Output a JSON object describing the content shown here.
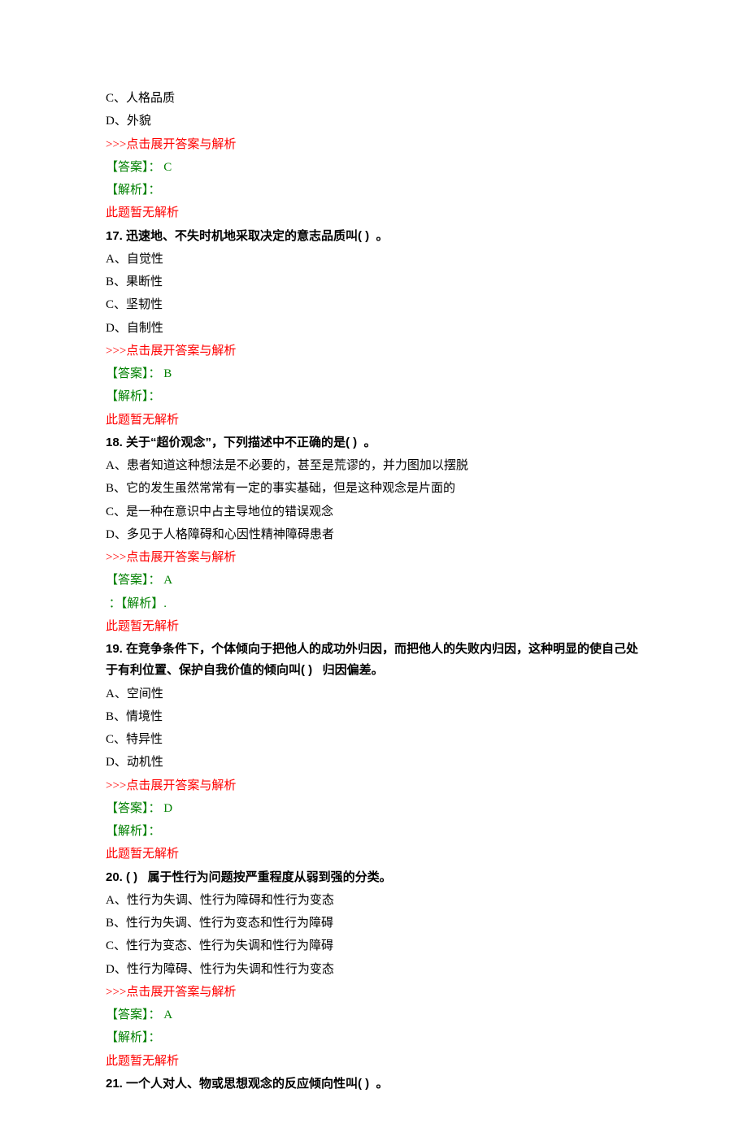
{
  "q16_tail": {
    "optC": "C、人格品质",
    "optD": "D、外貌",
    "toggle": ">>>点击展开答案与解析",
    "answer": "【答案】： C",
    "jiexiLabel": "【解析】：",
    "noJiexi": "此题暂无解析"
  },
  "q17": {
    "stem": "17. 迅速地、不失时机地采取决定的意志品质叫( )  。",
    "optA": "A、自觉性",
    "optB": "B、果断性",
    "optC": "C、坚韧性",
    "optD": "D、自制性",
    "toggle": ">>>点击展开答案与解析",
    "answer": "【答案】： B",
    "jiexiLabel": "【解析】：",
    "noJiexi": "此题暂无解析"
  },
  "q18": {
    "stem": "18. 关于“超价观念”，下列描述中不正确的是( )  。",
    "optA": "A、患者知道这种想法是不必要的，甚至是荒谬的，并力图加以摆脱",
    "optB": "B、它的发生虽然常常有一定的事实基础，但是这种观念是片面的",
    "optC": "C、是一种在意识中占主导地位的错误观念",
    "optD": "D、多见于人格障碍和心因性精神障碍患者",
    "toggle": ">>>点击展开答案与解析",
    "answer": "【答案】： A",
    "jiexiLine2": " ：【解析】.",
    "noJiexi": "此题暂无解析"
  },
  "q19": {
    "stem": "19. 在竞争条件下，个体倾向于把他人的成功外归因，而把他人的失败内归因，这种明显的使自己处于有利位置、保护自我价值的倾向叫( )   归因偏差。",
    "optA": "A、空间性",
    "optB": "B、情境性",
    "optC": "C、特异性",
    "optD": "D、动机性",
    "toggle": ">>>点击展开答案与解析",
    "answer": "【答案】： D",
    "jiexiLabel": "【解析】：",
    "noJiexi": "此题暂无解析"
  },
  "q20": {
    "stem": "20. ( )   属于性行为问题按严重程度从弱到强的分类。",
    "optA": "A、性行为失调、性行为障碍和性行为变态",
    "optB": "B、性行为失调、性行为变态和性行为障碍",
    "optC": "C、性行为变态、性行为失调和性行为障碍",
    "optD": "D、性行为障碍、性行为失调和性行为变态",
    "toggle": ">>>点击展开答案与解析",
    "answer": "【答案】： A",
    "jiexiLabel": "【解析】：",
    "noJiexi": "此题暂无解析"
  },
  "q21": {
    "stem": "21. 一个人对人、物或思想观念的反应倾向性叫( )  。"
  }
}
